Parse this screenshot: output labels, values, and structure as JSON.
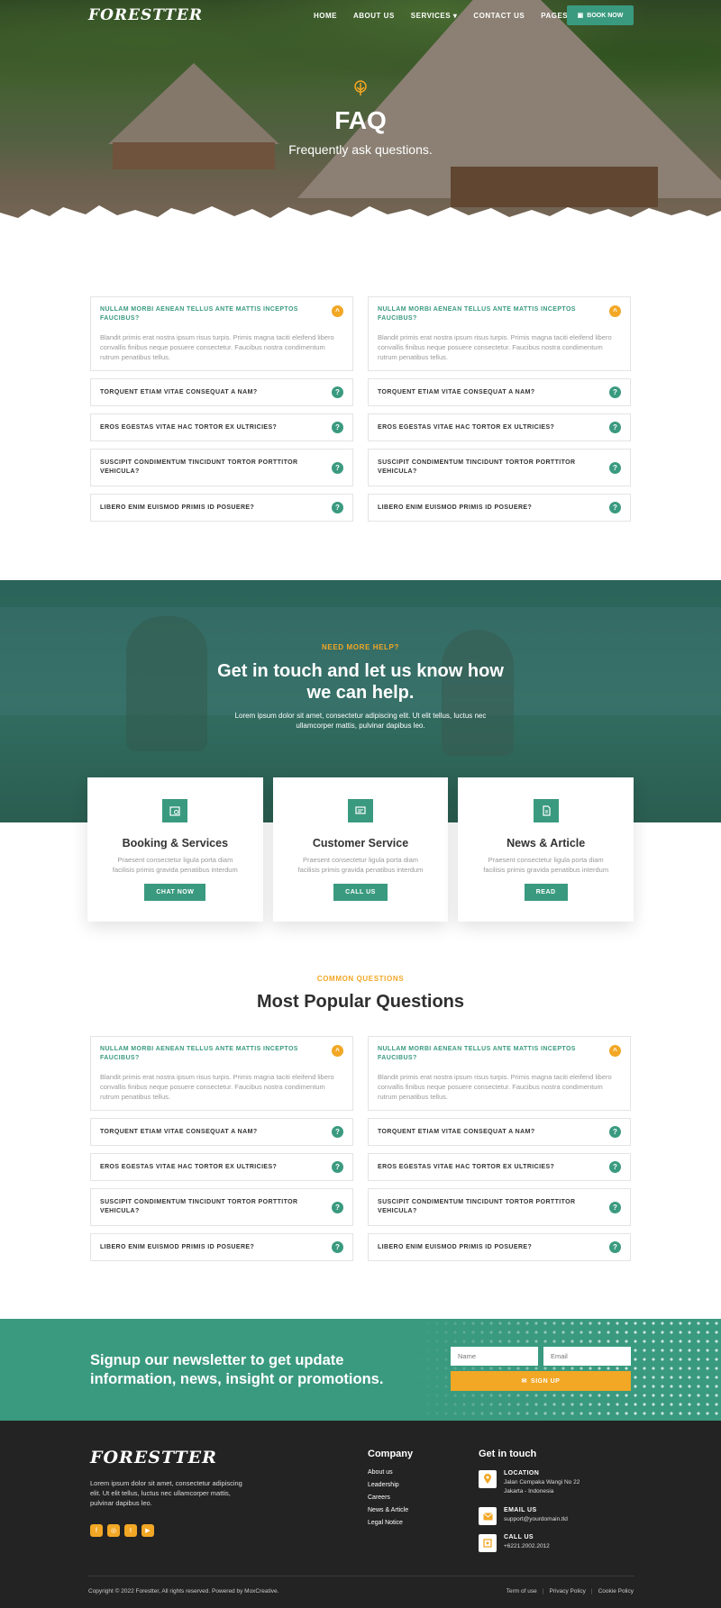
{
  "header": {
    "logo": "FORESTTER",
    "nav": [
      "HOME",
      "ABOUT US",
      "SERVICES",
      "CONTACT US",
      "PAGES"
    ],
    "book_label": "BOOK NOW"
  },
  "hero": {
    "title": "FAQ",
    "subtitle": "Frequently ask questions."
  },
  "faq_open": {
    "question": "NULLAM MORBI AENEAN TELLUS ANTE MATTIS INCEPTOS FAUCIBUS?",
    "answer": "Blandit primis erat nostra ipsum risus turpis. Primis magna taciti eleifend libero convallis finibus neque posuere consectetur. Faucibus nostra condimentum rutrum penatibus tellus."
  },
  "faq_questions": [
    "TORQUENT ETIAM VITAE CONSEQUAT A NAM?",
    "EROS EGESTAS VITAE HAC TORTOR EX ULTRICIES?",
    "SUSCIPIT CONDIMENTUM TINCIDUNT TORTOR PORTTITOR VEHICULA?",
    "LIBERO ENIM EUISMOD PRIMIS ID POSUERE?"
  ],
  "contact": {
    "eyebrow": "NEED MORE HELP?",
    "title": "Get in touch and let us know how we can help.",
    "text": "Lorem ipsum dolor sit amet, consectetur adipiscing elit. Ut elit tellus, luctus nec ullamcorper mattis, pulvinar dapibus leo.",
    "cards": [
      {
        "title": "Booking & Services",
        "desc": "Praesent consectetur ligula porta diam facilisis primis gravida penatibus interdum",
        "button": "CHAT NOW"
      },
      {
        "title": "Customer Service",
        "desc": "Praesent consectetur ligula porta diam facilisis primis gravida penatibus interdum",
        "button": "CALL US"
      },
      {
        "title": "News & Article",
        "desc": "Praesent consectetur ligula porta diam facilisis primis gravida penatibus interdum",
        "button": "READ"
      }
    ]
  },
  "popular": {
    "eyebrow": "COMMON QUESTIONS",
    "title": "Most Popular Questions"
  },
  "newsletter": {
    "title": "Signup our newsletter to get update information, news, insight or promotions.",
    "name_placeholder": "Name",
    "email_placeholder": "Email",
    "button": "SIGN UP"
  },
  "footer": {
    "logo": "FORESTTER",
    "desc": "Lorem ipsum dolor sit amet, consectetur adipiscing elit. Ut elit tellus, luctus nec ullamcorper mattis, pulvinar dapibus leo.",
    "company_heading": "Company",
    "company_links": [
      "About us",
      "Leadership",
      "Careers",
      "News & Article",
      "Legal Notice"
    ],
    "touch_heading": "Get in touch",
    "location_label": "LOCATION",
    "location_value": "Jalan Cempaka Wangi No 22 Jakarta - Indonesia",
    "email_label": "EMAIL US",
    "email_value": "support@yourdomain.tld",
    "call_label": "CALL US",
    "call_value": "+6221.2002.2012",
    "copyright": "Copyright © 2022 Forestter, All rights reserved. Powered by MoxCreative.",
    "legal": [
      "Term of use",
      "Privacy Policy",
      "Cookie Policy"
    ]
  },
  "colors": {
    "accent": "#3a9a7f",
    "highlight": "#f2a725",
    "dark": "#232323"
  }
}
